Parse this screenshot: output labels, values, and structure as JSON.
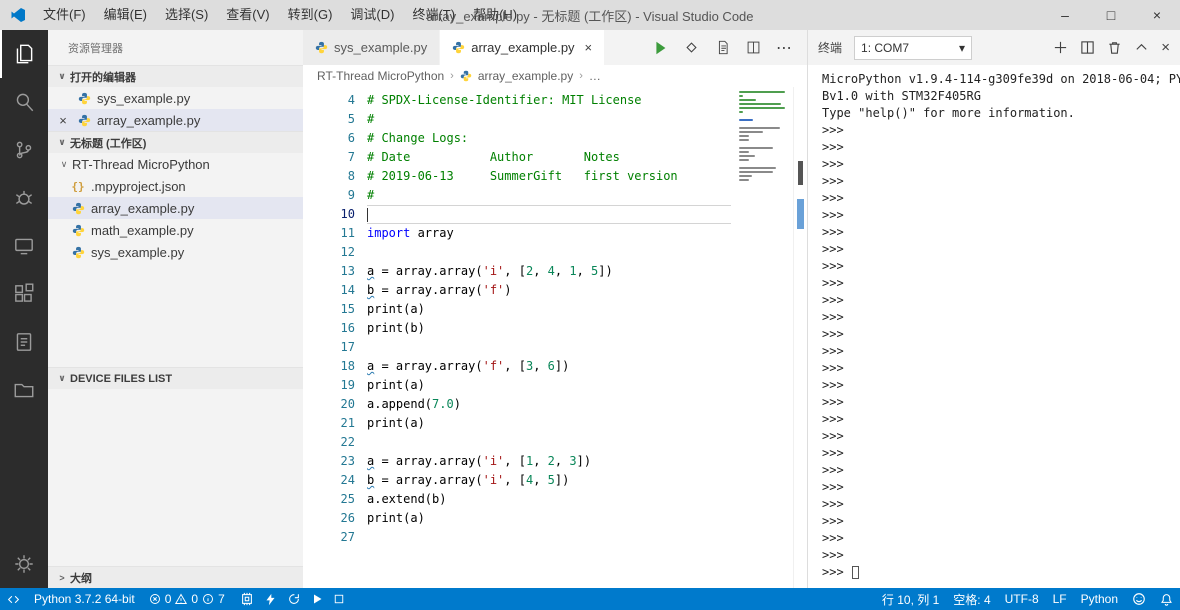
{
  "palette": {
    "accent": "#007acc",
    "activity_bar": "#2c2c2c",
    "selection": "#e4e6f1",
    "comment": "#008000",
    "keyword": "#0000ff",
    "string": "#a31515",
    "number": "#098658"
  },
  "title_bar": {
    "menus": [
      "文件(F)",
      "编辑(E)",
      "选择(S)",
      "查看(V)",
      "转到(G)",
      "调试(D)",
      "终端(T)",
      "帮助(H)"
    ],
    "title": "array_example.py - 无标题 (工作区) - Visual Studio Code",
    "controls": {
      "minimize": "–",
      "maximize": "□",
      "close": "×"
    }
  },
  "activity_bar": {
    "items": [
      "explorer",
      "search",
      "source-control",
      "debug",
      "remote-device",
      "extensions",
      "notes",
      "folders",
      "settings"
    ]
  },
  "sidebar": {
    "title": "资源管理器",
    "open_editors": {
      "label": "打开的编辑器",
      "items": [
        {
          "name": "sys_example.py"
        },
        {
          "name": "array_example.py",
          "close": "×"
        }
      ]
    },
    "workspace": {
      "label": "无标题 (工作区)",
      "folder": "RT-Thread MicroPython",
      "files": [
        {
          "name": ".mpyproject.json"
        },
        {
          "name": "array_example.py"
        },
        {
          "name": "math_example.py"
        },
        {
          "name": "sys_example.py"
        }
      ]
    },
    "device_files": {
      "label": "DEVICE FILES LIST"
    },
    "outline": {
      "label": "大纲"
    }
  },
  "editor": {
    "tabs": [
      {
        "label": "sys_example.py"
      },
      {
        "label": "array_example.py",
        "close": "×"
      }
    ],
    "breadcrumb": {
      "root": "RT-Thread MicroPython",
      "file": "array_example.py",
      "symbol": "…"
    },
    "code": {
      "cursor_line": 10,
      "lines": [
        {
          "n": 4,
          "segs": [
            [
              "# SPDX-License-Identifier: MIT License",
              "cm"
            ]
          ]
        },
        {
          "n": 5,
          "segs": [
            [
              "#",
              "cm"
            ]
          ]
        },
        {
          "n": 6,
          "segs": [
            [
              "# Change Logs:",
              "cm"
            ]
          ]
        },
        {
          "n": 7,
          "segs": [
            [
              "# Date           Author       Notes",
              "cm"
            ]
          ]
        },
        {
          "n": 8,
          "segs": [
            [
              "# 2019-06-13     SummerGift   first version",
              "cm"
            ]
          ]
        },
        {
          "n": 9,
          "segs": [
            [
              "#",
              "cm"
            ]
          ]
        },
        {
          "n": 10,
          "segs": []
        },
        {
          "n": 11,
          "segs": [
            [
              "import",
              "kw"
            ],
            [
              " array",
              "df"
            ]
          ]
        },
        {
          "n": 12,
          "segs": []
        },
        {
          "n": 13,
          "segs": [
            [
              "a",
              "df sq"
            ],
            [
              " = array.array(",
              "df"
            ],
            [
              "'i'",
              "str"
            ],
            [
              ", [",
              "df"
            ],
            [
              "2",
              "num"
            ],
            [
              ", ",
              "df"
            ],
            [
              "4",
              "num"
            ],
            [
              ", ",
              "df"
            ],
            [
              "1",
              "num"
            ],
            [
              ", ",
              "df"
            ],
            [
              "5",
              "num"
            ],
            [
              "])",
              "df"
            ]
          ]
        },
        {
          "n": 14,
          "segs": [
            [
              "b",
              "df sq"
            ],
            [
              " = array.array(",
              "df"
            ],
            [
              "'f'",
              "str"
            ],
            [
              ")",
              "df"
            ]
          ]
        },
        {
          "n": 15,
          "segs": [
            [
              "print(a)",
              "df"
            ]
          ]
        },
        {
          "n": 16,
          "segs": [
            [
              "print(b)",
              "df"
            ]
          ]
        },
        {
          "n": 17,
          "segs": []
        },
        {
          "n": 18,
          "segs": [
            [
              "a",
              "df sq"
            ],
            [
              " = array.array(",
              "df"
            ],
            [
              "'f'",
              "str"
            ],
            [
              ", [",
              "df"
            ],
            [
              "3",
              "num"
            ],
            [
              ", ",
              "df"
            ],
            [
              "6",
              "num"
            ],
            [
              "])",
              "df"
            ]
          ]
        },
        {
          "n": 19,
          "segs": [
            [
              "print(a)",
              "df"
            ]
          ]
        },
        {
          "n": 20,
          "segs": [
            [
              "a.append(",
              "df"
            ],
            [
              "7.0",
              "num"
            ],
            [
              ")",
              "df"
            ]
          ]
        },
        {
          "n": 21,
          "segs": [
            [
              "print(a)",
              "df"
            ]
          ]
        },
        {
          "n": 22,
          "segs": []
        },
        {
          "n": 23,
          "segs": [
            [
              "a",
              "df sq"
            ],
            [
              " = array.array(",
              "df"
            ],
            [
              "'i'",
              "str"
            ],
            [
              ", [",
              "df"
            ],
            [
              "1",
              "num"
            ],
            [
              ", ",
              "df"
            ],
            [
              "2",
              "num"
            ],
            [
              ", ",
              "df"
            ],
            [
              "3",
              "num"
            ],
            [
              "])",
              "df"
            ]
          ]
        },
        {
          "n": 24,
          "segs": [
            [
              "b",
              "df sq"
            ],
            [
              " = array.array(",
              "df"
            ],
            [
              "'i'",
              "str"
            ],
            [
              ", [",
              "df"
            ],
            [
              "4",
              "num"
            ],
            [
              ", ",
              "df"
            ],
            [
              "5",
              "num"
            ],
            [
              "])",
              "df"
            ]
          ]
        },
        {
          "n": 25,
          "segs": [
            [
              "a.extend(b)",
              "df"
            ]
          ]
        },
        {
          "n": 26,
          "segs": [
            [
              "print(a)",
              "df"
            ]
          ]
        },
        {
          "n": 27,
          "segs": []
        }
      ]
    }
  },
  "terminal": {
    "label": "终端",
    "dropdown": "1: COM7",
    "lines": [
      "MicroPython v1.9.4-114-g309fe39d on 2018-06-04; PY",
      "Bv1.0 with STM32F405RG",
      "Type \"help()\" for more information."
    ],
    "prompt": ">>>",
    "prompt_count": 26
  },
  "status_bar": {
    "python": "Python 3.7.2 64-bit",
    "errors": "0",
    "warnings": "0",
    "info": "7",
    "line_col": "行 10, 列 1",
    "spaces": "空格: 4",
    "encoding": "UTF-8",
    "eol": "LF",
    "language": "Python"
  }
}
